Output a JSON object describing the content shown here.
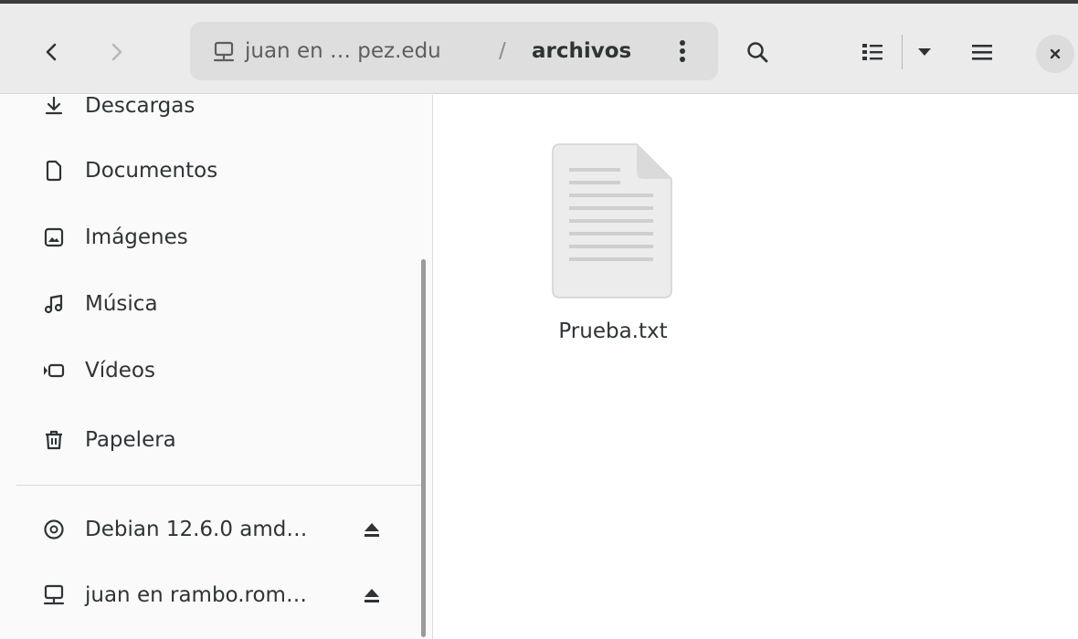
{
  "header": {
    "path_prefix": "juan en … pez.edu",
    "path_separator": "/",
    "path_current": "archivos",
    "icons": [
      "go-back-icon",
      "go-forward-icon",
      "remote-folder-icon",
      "path-menu-icon",
      "search-icon",
      "list-view-icon",
      "view-options-icon",
      "main-menu-icon",
      "close-icon"
    ]
  },
  "sidebar": {
    "items": [
      {
        "label": "Descargas",
        "icon": "download-icon"
      },
      {
        "label": "Documentos",
        "icon": "document-icon"
      },
      {
        "label": "Imágenes",
        "icon": "image-icon"
      },
      {
        "label": "Música",
        "icon": "music-icon"
      },
      {
        "label": "Vídeos",
        "icon": "video-icon"
      },
      {
        "label": "Papelera",
        "icon": "trash-icon"
      }
    ],
    "devices": [
      {
        "label": "Debian 12.6.0 amd…",
        "icon": "optical-disc-icon",
        "action_icon": "eject-icon"
      },
      {
        "label": "juan en rambo.rom…",
        "icon": "remote-folder-icon",
        "action_icon": "eject-icon"
      }
    ]
  },
  "content": {
    "files": [
      {
        "name": "Prueba.txt",
        "icon": "text-file-icon"
      }
    ]
  },
  "colors": {
    "headerbar": "#ebebeb",
    "pathbar": "#dedede",
    "sidebar": "#fafafa",
    "text": "#2e3436"
  }
}
